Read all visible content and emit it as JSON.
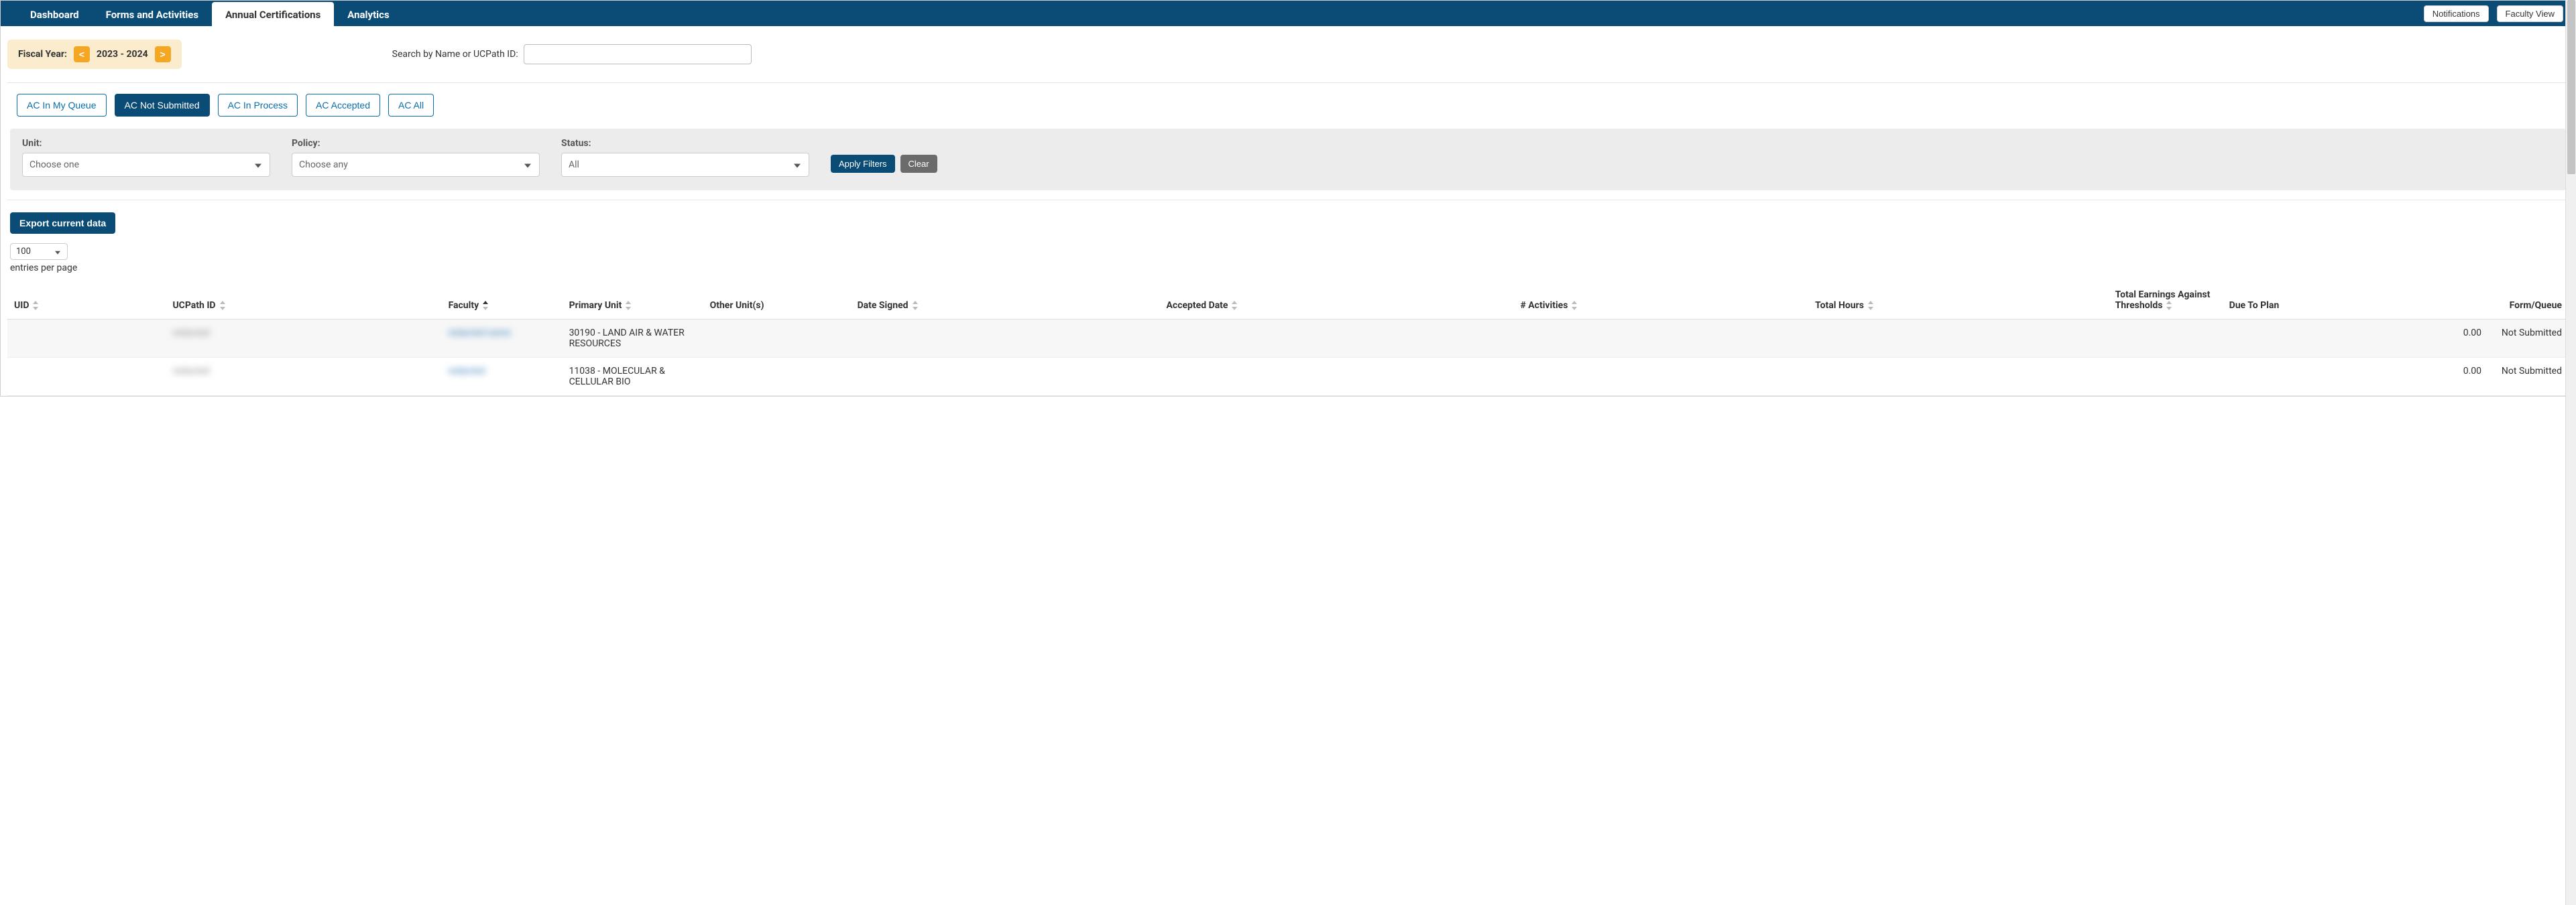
{
  "nav": {
    "tabs": [
      {
        "label": "Dashboard",
        "active": false
      },
      {
        "label": "Forms and Activities",
        "active": false
      },
      {
        "label": "Annual Certifications",
        "active": true
      },
      {
        "label": "Analytics",
        "active": false
      }
    ],
    "right": {
      "notifications": "Notifications",
      "faculty_view": "Faculty View"
    }
  },
  "fiscal_year": {
    "label": "Fiscal Year:",
    "prev": "<",
    "value": "2023 - 2024",
    "next": ">"
  },
  "search": {
    "label": "Search by Name or UCPath ID:",
    "value": ""
  },
  "ac_buttons": [
    {
      "label": "AC In My Queue",
      "active": false
    },
    {
      "label": "AC Not Submitted",
      "active": true
    },
    {
      "label": "AC In Process",
      "active": false
    },
    {
      "label": "AC Accepted",
      "active": false
    },
    {
      "label": "AC All",
      "active": false
    }
  ],
  "filters": {
    "unit": {
      "label": "Unit:",
      "value": "Choose one"
    },
    "policy": {
      "label": "Policy:",
      "value": "Choose any"
    },
    "status": {
      "label": "Status:",
      "value": "All"
    },
    "apply": "Apply Filters",
    "clear": "Clear"
  },
  "export_label": "Export current data",
  "page_size": {
    "value": "100",
    "suffix": "entries per page"
  },
  "columns": [
    {
      "label": "UID",
      "sortable": true
    },
    {
      "label": "UCPath ID",
      "sortable": true
    },
    {
      "label": "Faculty",
      "sortable": true,
      "sorted": "asc"
    },
    {
      "label": "Primary Unit",
      "sortable": true
    },
    {
      "label": "Other Unit(s)",
      "sortable": false
    },
    {
      "label": "Date Signed",
      "sortable": true
    },
    {
      "label": "Accepted Date",
      "sortable": true
    },
    {
      "label": "# Activities",
      "sortable": true
    },
    {
      "label": "Total Hours",
      "sortable": true
    },
    {
      "label": "Total Earnings Against Thresholds",
      "sortable": true
    },
    {
      "label": "Due To Plan",
      "sortable": false
    },
    {
      "label": "Form/Queue",
      "sortable": false
    }
  ],
  "rows": [
    {
      "uid": "",
      "ucpath_id": "redacted",
      "faculty": "redacted name",
      "primary_unit": "30190 - LAND AIR & WATER RESOURCES",
      "other_units": "",
      "date_signed": "",
      "accepted_date": "",
      "activities": "",
      "total_hours": "",
      "earnings": "",
      "due_to_plan": "0.00",
      "form_queue": "Not Submitted"
    },
    {
      "uid": "",
      "ucpath_id": "redacted",
      "faculty": "redacted",
      "primary_unit": "11038 - MOLECULAR & CELLULAR BIO",
      "other_units": "",
      "date_signed": "",
      "accepted_date": "",
      "activities": "",
      "total_hours": "",
      "earnings": "",
      "due_to_plan": "0.00",
      "form_queue": "Not Submitted"
    }
  ]
}
